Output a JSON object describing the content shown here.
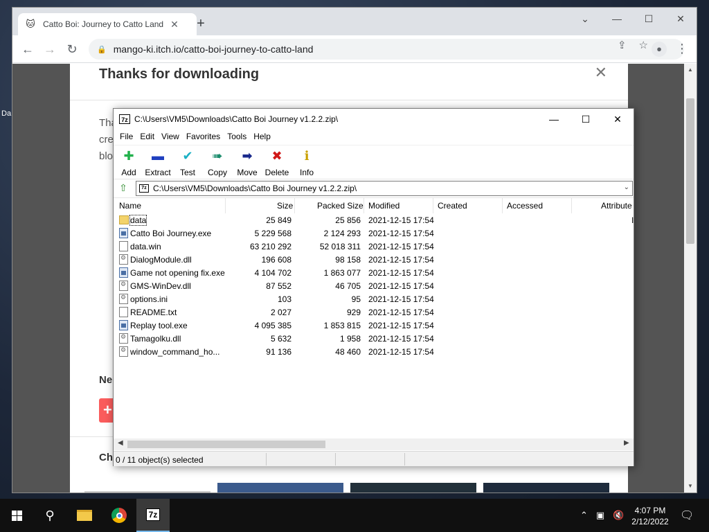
{
  "desktop": {
    "label": "Da"
  },
  "browser": {
    "tab_title": "Catto Boi: Journey to Catto Land",
    "url": "mango-ki.itch.io/catto-boi-journey-to-catto-land",
    "page": {
      "dialog_title": "Thanks for downloading",
      "para_fragments": [
        "Tha",
        "cre",
        "blo"
      ],
      "section_next": "Ne",
      "section_check": "Ch"
    }
  },
  "zip": {
    "title": "C:\\Users\\VM5\\Downloads\\Catto Boi Journey v1.2.2.zip\\",
    "icon_text": "7z",
    "menu": [
      "File",
      "Edit",
      "View",
      "Favorites",
      "Tools",
      "Help"
    ],
    "tools": [
      {
        "label": "Add",
        "icon": "plus-icon",
        "color": "#22b14c"
      },
      {
        "label": "Extract",
        "icon": "minus-icon",
        "color": "#1f3fbf"
      },
      {
        "label": "Test",
        "icon": "check-icon",
        "color": "#1ab0c4"
      },
      {
        "label": "Copy",
        "icon": "double-arrow-icon",
        "color": "#1a8c6c"
      },
      {
        "label": "Move",
        "icon": "arrow-right-icon",
        "color": "#1a2a8c"
      },
      {
        "label": "Delete",
        "icon": "x-icon",
        "color": "#d01818"
      },
      {
        "label": "Info",
        "icon": "info-icon",
        "color": "#c9a000"
      }
    ],
    "path": "C:\\Users\\VM5\\Downloads\\Catto Boi Journey v1.2.2.zip\\",
    "columns": [
      "Name",
      "Size",
      "Packed Size",
      "Modified",
      "Created",
      "Accessed",
      "Attribute"
    ],
    "files": [
      {
        "name": "data",
        "type": "folder",
        "size": "25 849",
        "packed": "25 856",
        "modified": "2021-12-15 17:54",
        "attr": "I"
      },
      {
        "name": "Catto Boi Journey.exe",
        "type": "exe",
        "size": "5 229 568",
        "packed": "2 124 293",
        "modified": "2021-12-15 17:54",
        "attr": ""
      },
      {
        "name": "data.win",
        "type": "file",
        "size": "63 210 292",
        "packed": "52 018 311",
        "modified": "2021-12-15 17:54",
        "attr": ""
      },
      {
        "name": "DialogModule.dll",
        "type": "dll",
        "size": "196 608",
        "packed": "98 158",
        "modified": "2021-12-15 17:54",
        "attr": ""
      },
      {
        "name": "Game not opening fix.exe",
        "type": "exe",
        "size": "4 104 702",
        "packed": "1 863 077",
        "modified": "2021-12-15 17:54",
        "attr": ""
      },
      {
        "name": "GMS-WinDev.dll",
        "type": "dll",
        "size": "87 552",
        "packed": "46 705",
        "modified": "2021-12-15 17:54",
        "attr": ""
      },
      {
        "name": "options.ini",
        "type": "dll",
        "size": "103",
        "packed": "95",
        "modified": "2021-12-15 17:54",
        "attr": ""
      },
      {
        "name": "README.txt",
        "type": "file",
        "size": "2 027",
        "packed": "929",
        "modified": "2021-12-15 17:54",
        "attr": ""
      },
      {
        "name": "Replay tool.exe",
        "type": "exe",
        "size": "4 095 385",
        "packed": "1 853 815",
        "modified": "2021-12-15 17:54",
        "attr": ""
      },
      {
        "name": "Tamagolku.dll",
        "type": "dll",
        "size": "5 632",
        "packed": "1 958",
        "modified": "2021-12-15 17:54",
        "attr": ""
      },
      {
        "name": "window_command_ho...",
        "type": "dll",
        "size": "91 136",
        "packed": "48 460",
        "modified": "2021-12-15 17:54",
        "attr": ""
      }
    ],
    "status": "0 / 11 object(s) selected"
  },
  "taskbar": {
    "time": "4:07 PM",
    "date": "2/12/2022",
    "active_app": "7z"
  }
}
